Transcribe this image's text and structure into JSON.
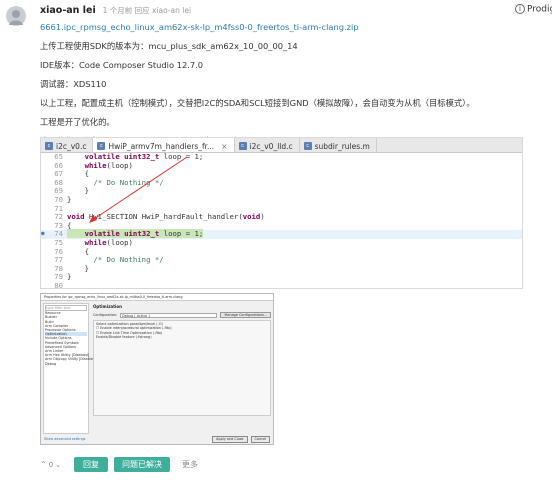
{
  "post": {
    "author": "xiao-an lei",
    "meta": "1 个月前 回应 xiao-an lei",
    "top_right_label": "Prodig",
    "attachment": "6661.ipc_rpmsg_echo_linux_am62x-sk-lp_m4fss0-0_freertos_ti-arm-clang.zip",
    "lines": [
      "上传工程使用SDK的版本为：mcu_plus_sdk_am62x_10_00_00_14",
      "IDE版本：Code Composer Studio 12.7.0",
      "调试器：XDS110",
      "以上工程，配置成主机（控制模式），交替把I2C的SDA和SCL短接到GND（模拟故障），会自动变为从机（目标模式）。",
      "工程是开了优化的。",
      "没开优化是进来HwiP_hardFault_handler，如下图片所示："
    ]
  },
  "ide": {
    "tabs": [
      {
        "label": "i2c_v0.c",
        "active": false
      },
      {
        "label": "HwiP_armv7m_handlers_fr...",
        "active": true
      },
      {
        "label": "i2c_v0_lld.c",
        "active": false
      },
      {
        "label": "subdir_rules.m",
        "active": false
      }
    ],
    "code": [
      {
        "num": "65",
        "text": "    volatile uint32_t loop = 1;"
      },
      {
        "num": "66",
        "text": "    while(loop)"
      },
      {
        "num": "67",
        "text": "    {"
      },
      {
        "num": "68",
        "text": "      /* Do Nothing */"
      },
      {
        "num": "69",
        "text": "    }"
      },
      {
        "num": "70",
        "text": "}"
      },
      {
        "num": "71",
        "text": ""
      },
      {
        "num": "72",
        "text": "void HwI_SECTION HwiP_hardFault_handler(void)"
      },
      {
        "num": "73",
        "text": "{"
      },
      {
        "num": "74",
        "text": "    volatile uint32_t loop = 1;"
      },
      {
        "num": "75",
        "text": "    while(loop)"
      },
      {
        "num": "76",
        "text": "    {"
      },
      {
        "num": "77",
        "text": "      /* Do Nothing */"
      },
      {
        "num": "78",
        "text": "    }"
      },
      {
        "num": "79",
        "text": "}"
      },
      {
        "num": "80",
        "text": ""
      }
    ]
  },
  "dialog": {
    "title": "Properties for ipc_rpmsg_echo_linux_am62x-sk-lp_m4fss0-0_freertos_ti-arm-clang",
    "filter": "type filter text",
    "tree": [
      "Resource",
      "Builder",
      "Build",
      "  Arm Compiler",
      "    Processor Options",
      "    Optimization",
      "    Include Options",
      "    Predefined Symbols",
      "    Advanced Options",
      "  Arm Linker",
      "  Arm Hex Utility [Disabled]",
      "  Arm Objcopy Utility [Disabled]",
      "Debug"
    ],
    "section": "Optimization",
    "config_label": "Configuration:",
    "config_value": "Debug  [ Active ]",
    "manage_button": "Manage Configurations...",
    "options": [
      "Select optimization paradigm/level (-O)",
      "Enable interprocedural optimization (-flto)",
      "Enable Link Time Optimization (-flto)",
      "Enable/Disable feature (-fstrong)"
    ],
    "help_link": "Show advanced settings",
    "apply_close": "Apply and Close",
    "cancel": "Cancel"
  },
  "actions": {
    "vote_count": "0",
    "reply": "回复",
    "solved": "问题已解决",
    "more": "更多"
  }
}
